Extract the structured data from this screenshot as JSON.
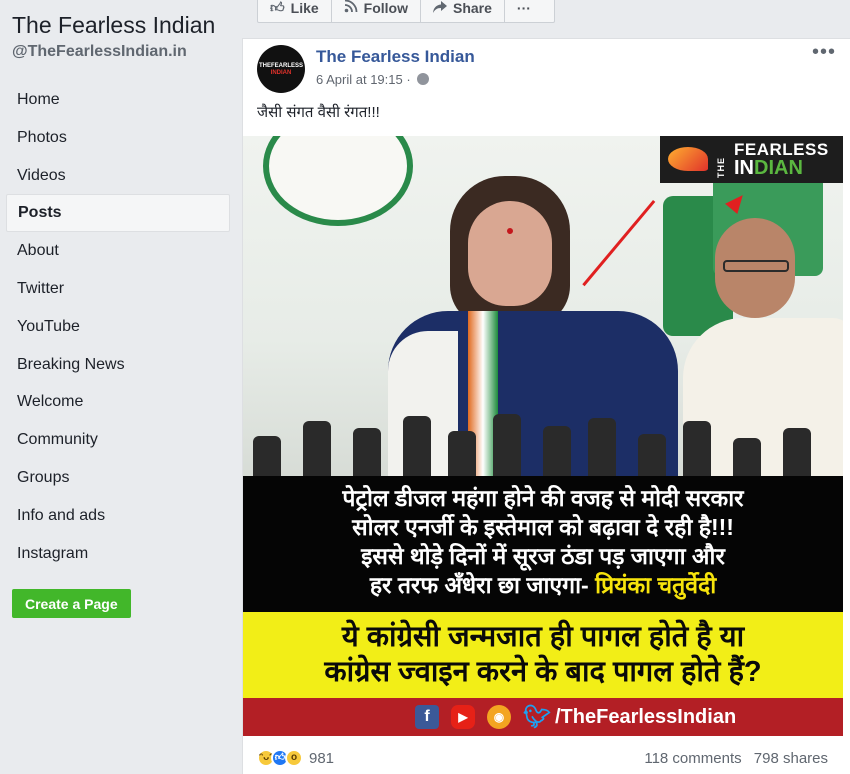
{
  "sidebar": {
    "page_name": "The Fearless Indian",
    "handle": "@TheFearlessIndian.in",
    "items": [
      {
        "label": "Home",
        "active": false
      },
      {
        "label": "Photos",
        "active": false
      },
      {
        "label": "Videos",
        "active": false
      },
      {
        "label": "Posts",
        "active": true
      },
      {
        "label": "About",
        "active": false
      },
      {
        "label": "Twitter",
        "active": false
      },
      {
        "label": "YouTube",
        "active": false
      },
      {
        "label": "Breaking News",
        "active": false
      },
      {
        "label": "Welcome",
        "active": false
      },
      {
        "label": "Community",
        "active": false
      },
      {
        "label": "Groups",
        "active": false
      },
      {
        "label": "Info and ads",
        "active": false
      },
      {
        "label": "Instagram",
        "active": false
      }
    ],
    "create_page_label": "Create a Page"
  },
  "action_bar": {
    "like_label": "Like",
    "follow_label": "Follow",
    "share_label": "Share",
    "more_label": "···"
  },
  "post": {
    "author": "The Fearless Indian",
    "timestamp": "6 April at 19:15",
    "more_label": "•••",
    "text": "जैसी संगत वैसी रंगत!!!",
    "avatar_text_top": "THEFEARLESS",
    "avatar_text_bottom": "INDIAN",
    "image": {
      "logo_the": "THE",
      "logo_fearless": "FEARLESS",
      "logo_indian_a": "IN",
      "logo_indian_b": "DIAN",
      "caption_lines": [
        "पेट्रोल डीजल महंगा होने की वजह से मोदी सरकार",
        "सोलर एनर्जी के इस्तेमाल को बढ़ावा दे रही है!!!",
        "इससे थोड़े दिनों में सूरज ठंडा पड़ जाएगा और"
      ],
      "caption_last_prefix": "हर तरफ अँधेरा छा जाएगा- ",
      "caption_last_name": "प्रियंका चतुर्वेदी",
      "yellow_lines": [
        "ये कांग्रेसी जन्मजात ही पागल होते है या",
        "कांग्रेस ज्वाइन करने के बाद पागल होते हैं?"
      ],
      "footer_handle": "/TheFearlessIndian"
    },
    "reactions_count": "981",
    "comments": "118 comments",
    "shares": "798 shares"
  },
  "colors": {
    "link_blue": "#365899",
    "create_green": "#42b72a",
    "caption_yellow": "#f2ee17",
    "footer_red": "#b31f25"
  }
}
